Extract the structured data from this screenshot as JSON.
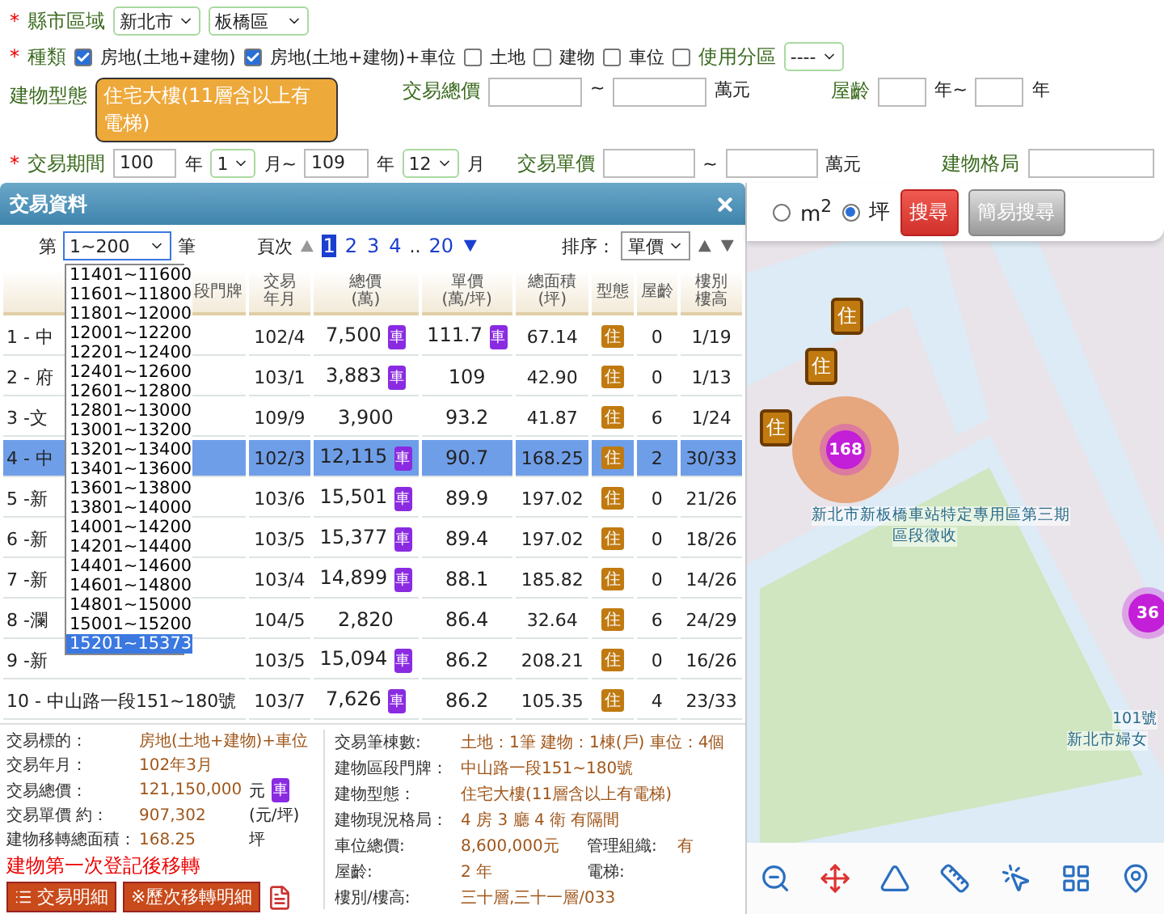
{
  "region": {
    "required_mark": "*",
    "label": "縣市區域",
    "city": "新北市",
    "district": "板橋區"
  },
  "category": {
    "required_mark": "*",
    "label": "種類",
    "options": [
      {
        "label": "房地(土地+建物)",
        "checked": true
      },
      {
        "label": "房地(土地+建物)+車位",
        "checked": true
      },
      {
        "label": "土地",
        "checked": false
      },
      {
        "label": "建物",
        "checked": false
      },
      {
        "label": "車位",
        "checked": false
      }
    ],
    "zoning": {
      "label": "使用分區",
      "checked": false,
      "value": "----"
    }
  },
  "building_type": {
    "label": "建物型態",
    "value": "住宅大樓(11層含以上有電梯)"
  },
  "total_price": {
    "label": "交易總價",
    "separator": "~",
    "unit": "萬元"
  },
  "age": {
    "label": "屋齡",
    "from_unit": "年~",
    "to_unit": "年"
  },
  "period": {
    "required_mark": "*",
    "label": "交易期間",
    "from_year": "100",
    "from_year_unit": "年",
    "from_month": "1",
    "from_month_unit": "月~",
    "to_year": "109",
    "to_year_unit": "年",
    "to_month": "12",
    "to_month_unit": "月"
  },
  "unit_price": {
    "label": "交易單價",
    "separator": "~",
    "unit": "萬元"
  },
  "layout_field": {
    "label": "建物格局"
  },
  "panel": {
    "title": "交易資料",
    "range": {
      "prefix": "第",
      "value": "1~200",
      "suffix": "筆",
      "expanded": true,
      "options": [
        {
          "label": "11401~11600",
          "selected": false
        },
        {
          "label": "11601~11800",
          "selected": false
        },
        {
          "label": "11801~12000",
          "selected": false
        },
        {
          "label": "12001~12200",
          "selected": false
        },
        {
          "label": "12201~12400",
          "selected": false
        },
        {
          "label": "12401~12600",
          "selected": false
        },
        {
          "label": "12601~12800",
          "selected": false
        },
        {
          "label": "12801~13000",
          "selected": false
        },
        {
          "label": "13001~13200",
          "selected": false
        },
        {
          "label": "13201~13400",
          "selected": false
        },
        {
          "label": "13401~13600",
          "selected": false
        },
        {
          "label": "13601~13800",
          "selected": false
        },
        {
          "label": "13801~14000",
          "selected": false
        },
        {
          "label": "14001~14200",
          "selected": false
        },
        {
          "label": "14201~14400",
          "selected": false
        },
        {
          "label": "14401~14600",
          "selected": false
        },
        {
          "label": "14601~14800",
          "selected": false
        },
        {
          "label": "14801~15000",
          "selected": false
        },
        {
          "label": "15001~15200",
          "selected": false
        },
        {
          "label": "15201~15373",
          "selected": true
        }
      ]
    },
    "pager": {
      "label": "頁次",
      "pages": [
        {
          "kind": "page",
          "label": "1",
          "selected": true
        },
        {
          "kind": "page",
          "label": "2",
          "selected": false
        },
        {
          "kind": "page",
          "label": "3",
          "selected": false
        },
        {
          "kind": "page",
          "label": "4",
          "selected": false
        },
        {
          "kind": "gap",
          "label": ".."
        },
        {
          "kind": "page",
          "label": "20",
          "selected": false
        }
      ]
    },
    "sort": {
      "label": "排序：",
      "value": "單價"
    },
    "table": {
      "columns": [
        [
          "段門牌"
        ],
        [
          "交易",
          "年月"
        ],
        [
          "總價",
          "(萬)"
        ],
        [
          "單價",
          "(萬/坪)"
        ],
        [
          "總面積",
          "(坪)"
        ],
        [
          "型態"
        ],
        [
          "屋齡"
        ],
        [
          "樓別",
          "樓高"
        ]
      ],
      "rows": [
        {
          "address": "1 - 中",
          "date": "102/4",
          "total": "7,500",
          "total_badge": "車",
          "unit": "111.7",
          "unit_badge": "車",
          "area": "67.14",
          "type": "住",
          "age": "0",
          "floor": "1/19",
          "selected": false
        },
        {
          "address": "2 - 府",
          "date": "103/1",
          "total": "3,883",
          "total_badge": "車",
          "unit": "109",
          "area": "42.90",
          "type": "住",
          "age": "0",
          "floor": "1/13",
          "selected": false
        },
        {
          "address": "3 -文",
          "date": "109/9",
          "total": "3,900",
          "unit": "93.2",
          "area": "41.87",
          "type": "住",
          "age": "6",
          "floor": "1/24",
          "selected": false
        },
        {
          "address": "4 - 中",
          "date": "102/3",
          "total": "12,115",
          "total_badge": "車",
          "unit": "90.7",
          "area": "168.25",
          "type": "住",
          "age": "2",
          "floor": "30/33",
          "selected": true
        },
        {
          "address": "5 -新",
          "date": "103/6",
          "total": "15,501",
          "total_badge": "車",
          "unit": "89.9",
          "area": "197.02",
          "type": "住",
          "age": "0",
          "floor": "21/26",
          "selected": false
        },
        {
          "address": "6 -新",
          "date": "103/5",
          "total": "15,377",
          "total_badge": "車",
          "unit": "89.4",
          "area": "197.02",
          "type": "住",
          "age": "0",
          "floor": "18/26",
          "selected": false
        },
        {
          "address": "7 -新",
          "date": "103/4",
          "total": "14,899",
          "total_badge": "車",
          "unit": "88.1",
          "area": "185.82",
          "type": "住",
          "age": "0",
          "floor": "14/26",
          "selected": false
        },
        {
          "address": "8 -瀾",
          "date": "104/5",
          "total": "2,820",
          "unit": "86.4",
          "area": "32.64",
          "type": "住",
          "age": "6",
          "floor": "24/29",
          "selected": false
        },
        {
          "address": "9 -新",
          "date": "103/5",
          "total": "15,094",
          "total_badge": "車",
          "unit": "86.2",
          "area": "208.21",
          "type": "住",
          "age": "0",
          "floor": "16/26",
          "selected": false
        },
        {
          "address": "10 - 中山路一段151~180號",
          "date": "103/7",
          "total": "7,626",
          "total_badge": "車",
          "unit": "86.2",
          "area": "105.35",
          "type": "住",
          "age": "4",
          "floor": "23/33",
          "selected": false
        }
      ]
    },
    "details": {
      "left": [
        {
          "label": "交易標的：",
          "value": "房地(土地+建物)+車位"
        },
        {
          "label": "交易年月：",
          "value": "102年3月"
        },
        {
          "label": "交易總價：",
          "value": "121,150,000",
          "unit": "元",
          "badge": "車"
        },
        {
          "label": "交易單價 約：",
          "value": "907,302",
          "unit": "(元/坪)"
        },
        {
          "label": "建物移轉總面積：",
          "value": "168.25",
          "unit": "坪"
        }
      ],
      "notice": "建物第一次登記後移轉",
      "buttons": [
        "交易明細",
        "※歷次移轉明細"
      ],
      "right": [
        {
          "label": "交易筆棟數:",
          "value": "土地：1筆 建物：1棟(戶) 車位：4個"
        },
        {
          "label": "建物區段門牌：",
          "value": "中山路一段151~180號"
        },
        {
          "label": "建物型態：",
          "value": "住宅大樓(11層含以上有電梯)"
        },
        {
          "label": "建物現況格局：",
          "value": "4 房 3 廳 4 衛 有隔間"
        },
        {
          "label": "車位總價:",
          "value": "8,600,000元",
          "extra_label": "管理組織:",
          "extra_value": "有"
        },
        {
          "label": "屋齡:",
          "value": "2 年",
          "extra_label": "電梯:"
        },
        {
          "label": "樓別/樓高:",
          "value": "三十層,三十一層/033"
        }
      ]
    }
  },
  "map": {
    "units": [
      {
        "label": "m$^{2}$",
        "selected": false
      },
      {
        "label": "坪",
        "selected": true
      }
    ],
    "search_button": "搜尋",
    "simple_search_button": "簡易搜尋",
    "markers": [
      {
        "kind": "house",
        "label": "住"
      },
      {
        "kind": "house",
        "label": "住"
      },
      {
        "kind": "house",
        "label": "住"
      },
      {
        "kind": "cluster",
        "label": "168",
        "halo": true
      },
      {
        "kind": "cluster",
        "label": "36",
        "halo": false
      }
    ],
    "labels": [
      "新北市新板橋車站特定專用區第三期",
      "區段徵收",
      "101號",
      "新北市婦女"
    ]
  }
}
